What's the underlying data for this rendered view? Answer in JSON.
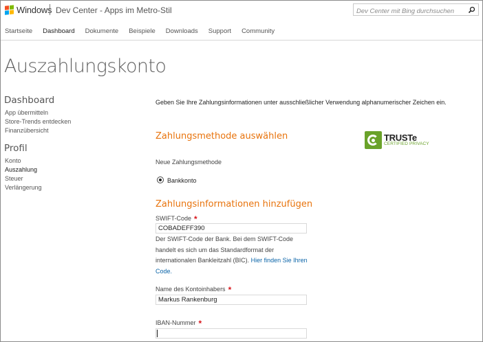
{
  "header": {
    "brand": "Windows",
    "site_title": "Dev Center - Apps im Metro-Stil",
    "search_placeholder": "Dev Center mit Bing durchsuchen",
    "logo_colors": [
      "#f25022",
      "#7fba00",
      "#00a4ef",
      "#ffb900"
    ]
  },
  "nav": {
    "items": [
      "Startseite",
      "Dashboard",
      "Dokumente",
      "Beispiele",
      "Downloads",
      "Support",
      "Community"
    ],
    "active": "Dashboard"
  },
  "page_title": "Auszahlungskonto",
  "sidebar": {
    "dashboard_heading": "Dashboard",
    "dashboard_links": [
      "App übermitteln",
      "Store-Trends entdecken",
      "Finanzübersicht"
    ],
    "profile_heading": "Profil",
    "profile_links": [
      "Konto",
      "Auszahlung",
      "Steuer",
      "Verlängerung"
    ],
    "current": "Auszahlung"
  },
  "main": {
    "intro": "Geben Sie Ihre Zahlungsinformationen unter ausschließlicher Verwendung alphanumerischer Zeichen ein.",
    "method_heading": "Zahlungsmethode auswählen",
    "new_method_label": "Neue Zahlungsmethode",
    "radio_label": "Bankkonto",
    "radio_selected": true,
    "info_heading": "Zahlungsinformationen hinzufügen",
    "swift_label": "SWIFT-Code",
    "swift_value": "COBADEFF390",
    "swift_help": "Der SWIFT-Code der Bank. Bei dem SWIFT-Code handelt es sich um das Standardformat der internationalen Bankleitzahl (BIC).",
    "swift_help_link": "Hier finden Sie Ihren Code.",
    "holder_label": "Name des Kontoinhabers",
    "holder_value": "Markus Rankenburg",
    "iban_label": "IBAN-Nummer",
    "iban_value": "",
    "required_marker": "*"
  },
  "truste": {
    "name": "TRUSTe",
    "subtitle": "CERTIFIED PRIVACY",
    "color": "#6aa22a"
  },
  "colors": {
    "accent_heading": "#e8730c",
    "required": "#d8151b",
    "link": "#0a64a8"
  }
}
